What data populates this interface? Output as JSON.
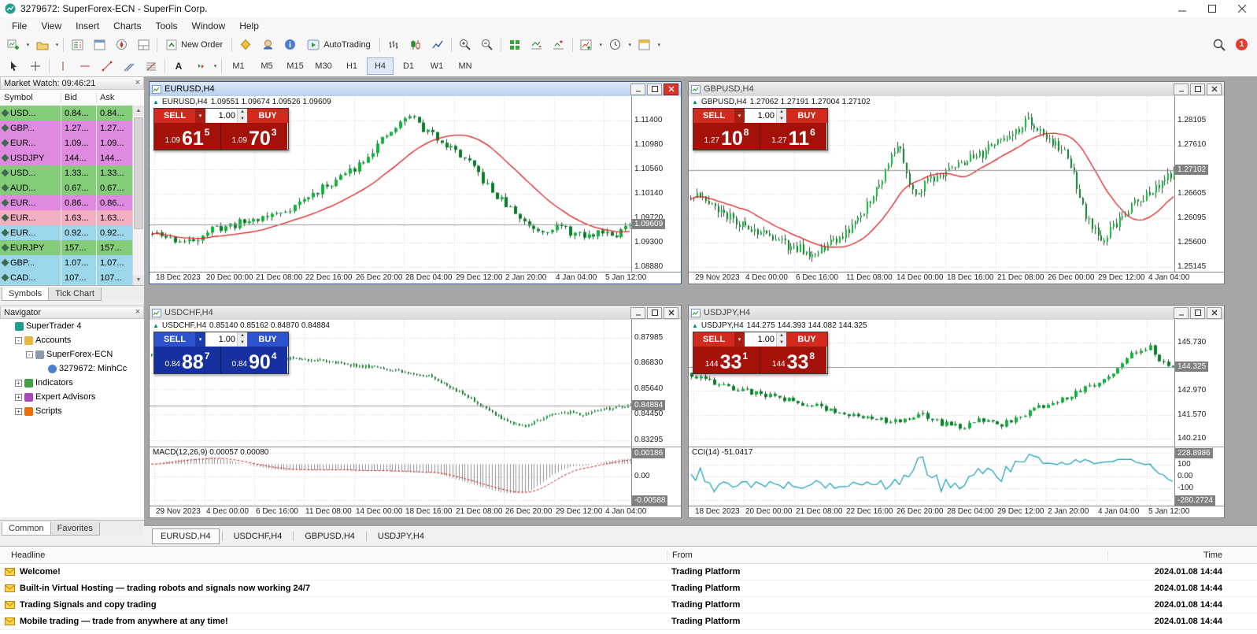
{
  "window": {
    "title": "3279672: SuperForex-ECN - SuperFin Corp."
  },
  "menu": [
    "File",
    "View",
    "Insert",
    "Charts",
    "Tools",
    "Window",
    "Help"
  ],
  "toolbar": {
    "new_order": "New Order",
    "autotrading": "AutoTrading",
    "notification_badge": "1",
    "timeframes": [
      "M1",
      "M5",
      "M15",
      "M30",
      "H1",
      "H4",
      "D1",
      "W1",
      "MN"
    ],
    "active_timeframe": "H4"
  },
  "market_watch": {
    "title": "Market Watch: 09:46:21",
    "columns": [
      "Symbol",
      "Bid",
      "Ask"
    ],
    "rows": [
      {
        "symbol": "USD...",
        "bid": "0.84...",
        "ask": "0.84...",
        "color": "green"
      },
      {
        "symbol": "GBP...",
        "bid": "1.27...",
        "ask": "1.27...",
        "color": "violet"
      },
      {
        "symbol": "EUR...",
        "bid": "1.09...",
        "ask": "1.09...",
        "color": "violet"
      },
      {
        "symbol": "USDJPY",
        "bid": "144...",
        "ask": "144...",
        "color": "violet"
      },
      {
        "symbol": "USD...",
        "bid": "1.33...",
        "ask": "1.33...",
        "color": "green"
      },
      {
        "symbol": "AUD...",
        "bid": "0.67...",
        "ask": "0.67...",
        "color": "green"
      },
      {
        "symbol": "EUR...",
        "bid": "0.86...",
        "ask": "0.86...",
        "color": "violet"
      },
      {
        "symbol": "EUR...",
        "bid": "1.63...",
        "ask": "1.63...",
        "color": "pink"
      },
      {
        "symbol": "EUR...",
        "bid": "0.92...",
        "ask": "0.92...",
        "color": "cyan"
      },
      {
        "symbol": "EURJPY",
        "bid": "157...",
        "ask": "157...",
        "color": "green"
      },
      {
        "symbol": "GBP...",
        "bid": "1.07...",
        "ask": "1.07...",
        "color": "cyan"
      },
      {
        "symbol": "CAD...",
        "bid": "107...",
        "ask": "107...",
        "color": "cyan"
      }
    ],
    "palette": {
      "green": "#85cc7a",
      "violet": "#de8ade",
      "pink": "#f2afc0",
      "cyan": "#9cd6ea"
    },
    "tabs": [
      "Symbols",
      "Tick Chart"
    ],
    "active_tab": "Symbols"
  },
  "navigator": {
    "title": "Navigator",
    "tree": [
      {
        "label": "SuperTrader 4",
        "level": 0,
        "expand": "",
        "icon": "platform-icon"
      },
      {
        "label": "Accounts",
        "level": 1,
        "expand": "minus",
        "icon": "accounts-icon"
      },
      {
        "label": "SuperForex-ECN",
        "level": 2,
        "expand": "minus",
        "icon": "server-icon"
      },
      {
        "label": "3279672: MinhCc",
        "level": 3,
        "expand": "",
        "icon": "account-icon"
      },
      {
        "label": "Indicators",
        "level": 1,
        "expand": "plus",
        "icon": "indicators-icon"
      },
      {
        "label": "Expert Advisors",
        "level": 1,
        "expand": "plus",
        "icon": "experts-icon"
      },
      {
        "label": "Scripts",
        "level": 1,
        "expand": "plus",
        "icon": "scripts-icon"
      }
    ],
    "tabs": [
      "Common",
      "Favorites"
    ],
    "active_tab": "Common"
  },
  "trade_widget": {
    "sell_label": "SELL",
    "buy_label": "BUY"
  },
  "chart_colors": {
    "up": "#10b23c",
    "down": "#0a7d2a",
    "wick": "#26512f",
    "ma": "#e02020",
    "grid": "#d4d4d4",
    "macd_hist": "#8f8f8f",
    "macd_signal": "#d02020",
    "cci": "#189fb4",
    "current_line": "#9a9a9a",
    "current_box": "#808080"
  },
  "charts": [
    {
      "id": "eurusd",
      "title": "EURUSD,H4",
      "scheme": "red",
      "active": true,
      "info_ohlc": "1.09551 1.09674 1.09526 1.09609",
      "sell": {
        "prefix": "1.09",
        "big": "61",
        "sup": "5"
      },
      "buy": {
        "prefix": "1.09",
        "big": "70",
        "sup": "3"
      },
      "volume": "1.00",
      "current": "1.09609",
      "axis": {
        "y_labels": [
          "1.11400",
          "1.10980",
          "1.10560",
          "1.10140",
          "1.09720",
          "1.09300",
          "1.08880"
        ],
        "top_val": 1.114,
        "bottom_val": 1.0888,
        "top_frac": 0.14,
        "bottom_frac": 0.97,
        "x_labels": [
          "18 Dec 2023",
          "20 Dec 00:00",
          "21 Dec 08:00",
          "22 Dec 16:00",
          "26 Dec 20:00",
          "28 Dec 04:00",
          "29 Dec 12:00",
          "2 Jan 20:00",
          "4 Jan 04:00",
          "5 Jan 12:00"
        ]
      },
      "indicator": null,
      "chart_data": {
        "type": "candlestick",
        "candles": 105,
        "noise": 0.0014,
        "ma": true,
        "seed": 11,
        "waypoints": [
          [
            0,
            1.0945
          ],
          [
            0.075,
            1.093
          ],
          [
            0.12,
            1.0952
          ],
          [
            0.17,
            1.0961
          ],
          [
            0.22,
            1.0972
          ],
          [
            0.27,
            1.0982
          ],
          [
            0.32,
            1.1005
          ],
          [
            0.37,
            1.1031
          ],
          [
            0.42,
            1.1057
          ],
          [
            0.47,
            1.1097
          ],
          [
            0.52,
            1.1136
          ],
          [
            0.54,
            1.1152
          ],
          [
            0.57,
            1.1123
          ],
          [
            0.6,
            1.111
          ],
          [
            0.65,
            1.1077
          ],
          [
            0.68,
            1.1051
          ],
          [
            0.71,
            1.1018
          ],
          [
            0.75,
            1.0988
          ],
          [
            0.78,
            1.0965
          ],
          [
            0.81,
            1.0952
          ],
          [
            0.85,
            1.0959
          ],
          [
            0.88,
            1.0946
          ],
          [
            0.91,
            1.0939
          ],
          [
            0.94,
            1.0952
          ],
          [
            0.97,
            1.0946
          ],
          [
            1,
            1.09609
          ]
        ]
      }
    },
    {
      "id": "gbpusd",
      "title": "GBPUSD,H4",
      "scheme": "red",
      "active": false,
      "info_ohlc": "1.27062 1.27191 1.27004 1.27102",
      "sell": {
        "prefix": "1.27",
        "big": "10",
        "sup": "8"
      },
      "buy": {
        "prefix": "1.27",
        "big": "11",
        "sup": "6"
      },
      "volume": "1.00",
      "current": "1.27102",
      "axis": {
        "y_labels": [
          "1.28105",
          "1.27610",
          "",
          "1.26605",
          "1.26095",
          "1.25600",
          "1.25145"
        ],
        "top_val": 1.28105,
        "bottom_val": 1.25145,
        "top_frac": 0.14,
        "bottom_frac": 0.97,
        "x_labels": [
          "29 Nov 2023",
          "4 Dec 00:00",
          "6 Dec 16:00",
          "11 Dec 08:00",
          "14 Dec 00:00",
          "18 Dec 16:00",
          "21 Dec 08:00",
          "26 Dec 00:00",
          "29 Dec 12:00",
          "4 Jan 04:00"
        ]
      },
      "indicator": null,
      "chart_data": {
        "type": "candlestick",
        "candles": 160,
        "noise": 0.0022,
        "ma": true,
        "seed": 23,
        "waypoints": [
          [
            0,
            1.2662
          ],
          [
            0.05,
            1.2632
          ],
          [
            0.1,
            1.2604
          ],
          [
            0.15,
            1.2582
          ],
          [
            0.2,
            1.2556
          ],
          [
            0.25,
            1.2545
          ],
          [
            0.3,
            1.2568
          ],
          [
            0.35,
            1.2612
          ],
          [
            0.4,
            1.2705
          ],
          [
            0.43,
            1.2767
          ],
          [
            0.46,
            1.2659
          ],
          [
            0.5,
            1.2692
          ],
          [
            0.55,
            1.2718
          ],
          [
            0.6,
            1.2742
          ],
          [
            0.65,
            1.2778
          ],
          [
            0.7,
            1.2808
          ],
          [
            0.74,
            1.2775
          ],
          [
            0.78,
            1.2738
          ],
          [
            0.82,
            1.2608
          ],
          [
            0.85,
            1.2566
          ],
          [
            0.89,
            1.2615
          ],
          [
            0.93,
            1.2652
          ],
          [
            0.97,
            1.2685
          ],
          [
            1,
            1.27102
          ]
        ]
      }
    },
    {
      "id": "usdchf",
      "title": "USDCHF,H4",
      "scheme": "blue",
      "active": false,
      "info_ohlc": "0.85140 0.85162 0.84870 0.84884",
      "sell": {
        "prefix": "0.84",
        "big": "88",
        "sup": "7"
      },
      "buy": {
        "prefix": "0.84",
        "big": "90",
        "sup": "4"
      },
      "volume": "1.00",
      "current": "0.84884",
      "axis": {
        "y_labels": [
          "0.87985",
          "0.86830",
          "0.85640",
          "0.84450",
          "0.83295"
        ],
        "top_val": 0.87985,
        "bottom_val": 0.83295,
        "top_frac": 0.14,
        "bottom_frac": 0.95,
        "x_labels": [
          "29 Nov 2023",
          "4 Dec 00:00",
          "6 Dec 16:00",
          "11 Dec 08:00",
          "14 Dec 00:00",
          "18 Dec 16:00",
          "21 Dec 08:00",
          "26 Dec 20:00",
          "29 Dec 12:00",
          "4 Jan 04:00"
        ]
      },
      "indicator": {
        "type": "macd",
        "label": "MACD(12,26,9) 0.00057 0.00080",
        "labels": [
          "0.00186",
          "0.00",
          "-0.00588"
        ],
        "top_val": 0.00186,
        "bottom_val": -0.00588,
        "pane_frac": 0.32
      },
      "chart_data": {
        "type": "candlestick",
        "candles": 160,
        "noise": 0.0014,
        "ma": false,
        "seed": 37,
        "waypoints": [
          [
            0,
            0.8716
          ],
          [
            0.06,
            0.8748
          ],
          [
            0.12,
            0.8762
          ],
          [
            0.18,
            0.8742
          ],
          [
            0.24,
            0.8714
          ],
          [
            0.3,
            0.87
          ],
          [
            0.36,
            0.869
          ],
          [
            0.42,
            0.8674
          ],
          [
            0.48,
            0.8658
          ],
          [
            0.54,
            0.864
          ],
          [
            0.58,
            0.8622
          ],
          [
            0.62,
            0.8576
          ],
          [
            0.66,
            0.8528
          ],
          [
            0.7,
            0.8468
          ],
          [
            0.74,
            0.8414
          ],
          [
            0.78,
            0.839
          ],
          [
            0.82,
            0.8435
          ],
          [
            0.86,
            0.8458
          ],
          [
            0.9,
            0.8448
          ],
          [
            0.95,
            0.8474
          ],
          [
            1,
            0.84884
          ]
        ]
      }
    },
    {
      "id": "usdjpy",
      "title": "USDJPY,H4",
      "scheme": "red",
      "active": false,
      "info_ohlc": "144.275 144.393 144.082 144.325",
      "sell": {
        "prefix": "144",
        "big": "33",
        "sup": "1"
      },
      "buy": {
        "prefix": "144",
        "big": "33",
        "sup": "8"
      },
      "volume": "1.00",
      "current": "144.325",
      "axis": {
        "y_labels": [
          "145.730",
          "",
          "142.970",
          "141.570",
          "140.210"
        ],
        "top_val": 145.73,
        "bottom_val": 140.21,
        "top_frac": 0.18,
        "bottom_frac": 0.94,
        "x_labels": [
          "18 Dec 2023",
          "20 Dec 00:00",
          "21 Dec 08:00",
          "22 Dec 16:00",
          "26 Dec 20:00",
          "28 Dec 04:00",
          "29 Dec 12:00",
          "2 Jan 20:00",
          "4 Jan 04:00",
          "5 Jan 12:00"
        ]
      },
      "indicator": {
        "type": "cci",
        "label": "CCI(14) -51.0417",
        "labels": [
          "228.8986",
          "100",
          "0.00",
          "-100",
          "-280.2724"
        ],
        "top_val": 228.8986,
        "bottom_val": -280.2724,
        "pane_frac": 0.32
      },
      "chart_data": {
        "type": "candlestick",
        "candles": 105,
        "noise": 0.3,
        "ma": false,
        "seed": 53,
        "waypoints": [
          [
            0,
            143.9
          ],
          [
            0.06,
            143.3
          ],
          [
            0.12,
            142.9
          ],
          [
            0.18,
            142.6
          ],
          [
            0.24,
            142.2
          ],
          [
            0.3,
            141.8
          ],
          [
            0.36,
            141.5
          ],
          [
            0.42,
            141.2
          ],
          [
            0.48,
            141.6
          ],
          [
            0.52,
            141.1
          ],
          [
            0.56,
            140.9
          ],
          [
            0.6,
            141.3
          ],
          [
            0.64,
            141.0
          ],
          [
            0.68,
            141.5
          ],
          [
            0.72,
            142.0
          ],
          [
            0.76,
            142.4
          ],
          [
            0.8,
            142.9
          ],
          [
            0.84,
            143.4
          ],
          [
            0.88,
            144.1
          ],
          [
            0.92,
            145.2
          ],
          [
            0.95,
            145.5
          ],
          [
            0.97,
            144.8
          ],
          [
            1,
            144.325
          ]
        ]
      }
    }
  ],
  "chart_tabs": {
    "items": [
      "EURUSD,H4",
      "USDCHF,H4",
      "GBPUSD,H4",
      "USDJPY,H4"
    ],
    "active": "EURUSD,H4"
  },
  "terminal": {
    "columns": [
      "Headline",
      "From",
      "Time"
    ],
    "rows": [
      {
        "headline": "Welcome!",
        "from": "Trading Platform",
        "time": "2024.01.08 14:44"
      },
      {
        "headline": "Built-in Virtual Hosting — trading robots and signals now working 24/7",
        "from": "Trading Platform",
        "time": "2024.01.08 14:44"
      },
      {
        "headline": "Trading Signals and copy trading",
        "from": "Trading Platform",
        "time": "2024.01.08 14:44"
      },
      {
        "headline": "Mobile trading — trade from anywhere at any time!",
        "from": "Trading Platform",
        "time": "2024.01.08 14:44"
      }
    ]
  }
}
